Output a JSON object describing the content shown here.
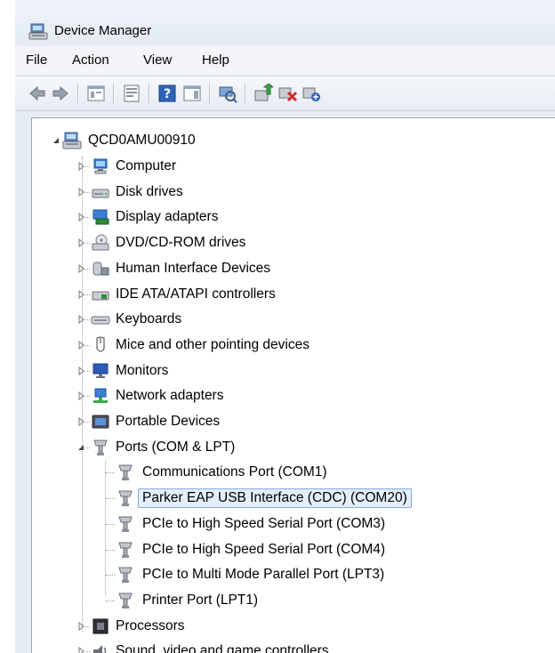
{
  "window": {
    "title": "Device Manager"
  },
  "menu": [
    "File",
    "Action",
    "View",
    "Help"
  ],
  "toolbar_icons": [
    "back-icon",
    "forward-icon",
    "show-hide-console-tree-icon",
    "properties-icon",
    "help-icon",
    "show-action-pane-icon",
    "scan-hardware-icon",
    "update-driver-icon",
    "uninstall-icon",
    "disable-icon"
  ],
  "tree": {
    "root": "QCD0AMU00910",
    "categories": [
      {
        "label": "Computer",
        "icon": "computer-icon"
      },
      {
        "label": "Disk drives",
        "icon": "disk-drive-icon"
      },
      {
        "label": "Display adapters",
        "icon": "display-adapter-icon"
      },
      {
        "label": "DVD/CD-ROM drives",
        "icon": "dvd-drive-icon"
      },
      {
        "label": "Human Interface Devices",
        "icon": "hid-icon"
      },
      {
        "label": "IDE ATA/ATAPI controllers",
        "icon": "ide-controller-icon"
      },
      {
        "label": "Keyboards",
        "icon": "keyboard-icon"
      },
      {
        "label": "Mice and other pointing devices",
        "icon": "mouse-icon"
      },
      {
        "label": "Monitors",
        "icon": "monitor-icon"
      },
      {
        "label": "Network adapters",
        "icon": "network-adapter-icon"
      },
      {
        "label": "Portable Devices",
        "icon": "portable-device-icon"
      },
      {
        "label": "Ports (COM & LPT)",
        "icon": "port-icon",
        "expanded": true
      },
      {
        "label": "Processors",
        "icon": "processor-icon"
      },
      {
        "label": "Sound, video and game controllers",
        "icon": "sound-icon"
      }
    ],
    "ports": [
      {
        "label": "Communications Port (COM1)"
      },
      {
        "label": "Parker EAP USB Interface (CDC) (COM20)",
        "selected": true
      },
      {
        "label": "PCIe to High Speed Serial Port (COM3)"
      },
      {
        "label": "PCIe to High Speed Serial Port (COM4)"
      },
      {
        "label": "PCIe to Multi Mode Parallel Port (LPT3)"
      },
      {
        "label": "Printer Port (LPT1)"
      }
    ]
  }
}
